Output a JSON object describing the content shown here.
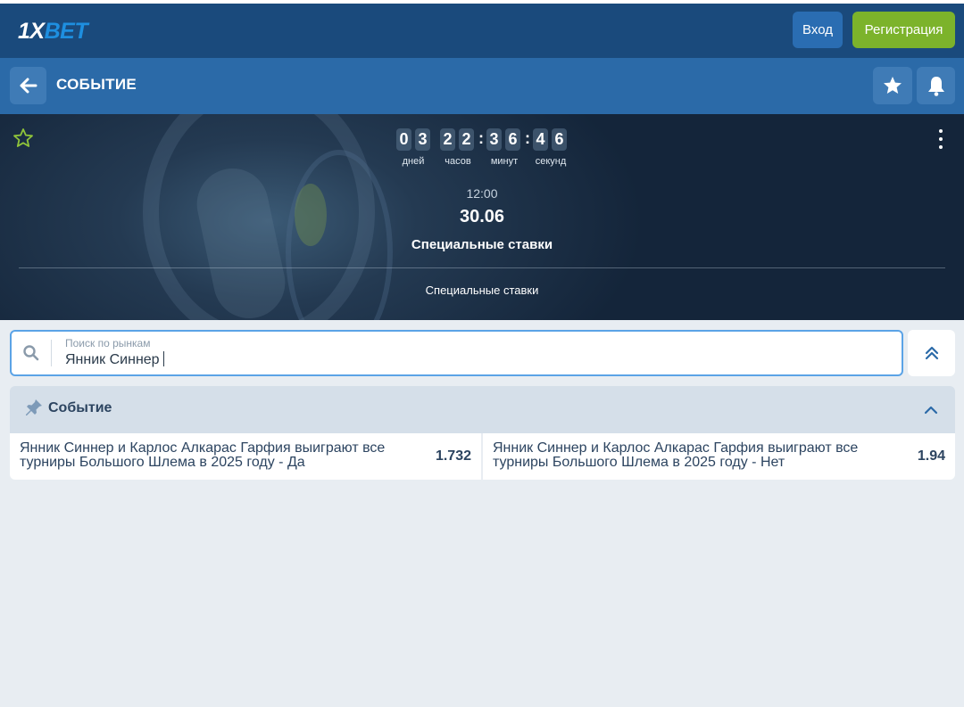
{
  "header": {
    "logo_main": "1X",
    "logo_accent": "BET",
    "login_label": "Вход",
    "register_label": "Регистрация"
  },
  "subbar": {
    "title": "СОБЫТИЕ"
  },
  "countdown": {
    "days": [
      "0",
      "3"
    ],
    "hours": [
      "2",
      "2"
    ],
    "minutes": [
      "3",
      "6"
    ],
    "seconds": [
      "4",
      "6"
    ],
    "days_label": "дней",
    "hours_label": "часов",
    "minutes_label": "минут",
    "seconds_label": "секунд",
    "separator": ":"
  },
  "event": {
    "time": "12:00",
    "date": "30.06",
    "name": "Специальные ставки",
    "tab": "Специальные ставки"
  },
  "search": {
    "label": "Поиск по рынкам",
    "value": "Янник Синнер"
  },
  "market": {
    "title": "Событие",
    "bets": [
      {
        "label": "Янник Синнер и Карлос Алкарас Гарфия выиграют все турниры Большого Шлема в 2025 году - Да",
        "odds": "1.732"
      },
      {
        "label": "Янник Синнер и Карлос Алкарас Гарфия выиграют все турниры Большого Шлема в 2025 году - Нет",
        "odds": "1.94"
      }
    ]
  },
  "colors": {
    "header_bg": "#1a4a7c",
    "subbar_bg": "#2b6aa8",
    "register_green": "#7cb32b",
    "star_outline": "#8fc43a"
  }
}
